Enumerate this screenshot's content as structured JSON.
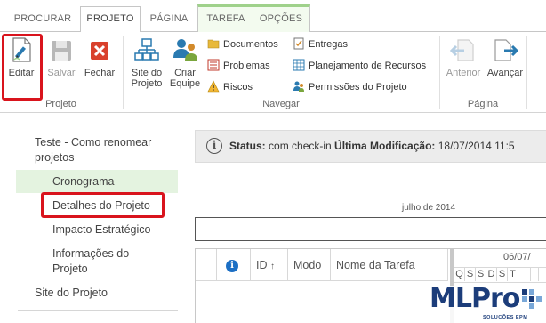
{
  "tabs": [
    {
      "label": "PROCURAR",
      "active": false
    },
    {
      "label": "PROJETO",
      "active": true
    },
    {
      "label": "PÁGINA",
      "active": false
    },
    {
      "label": "TAREFA",
      "active": false
    },
    {
      "label": "OPÇÕES",
      "active": false
    }
  ],
  "ribbon": {
    "projeto_group": {
      "label": "Projeto",
      "editar": "Editar",
      "salvar": "Salvar",
      "fechar": "Fechar"
    },
    "navegar_group": {
      "label": "Navegar",
      "site_do_projeto": [
        "Site do",
        "Projeto"
      ],
      "criar_equipe": [
        "Criar",
        "Equipe"
      ],
      "documentos": "Documentos",
      "problemas": "Problemas",
      "riscos": "Riscos",
      "entregas": "Entregas",
      "planejamento": "Planejamento de Recursos",
      "permissoes": "Permissões do Projeto"
    },
    "pagina_group": {
      "label": "Página",
      "anterior": "Anterior",
      "avancar": "Avançar"
    }
  },
  "nav": {
    "project_title": [
      "Teste - Como renomear",
      "projetos"
    ],
    "items": [
      "Cronograma",
      "Detalhes do Projeto",
      "Impacto Estratégico",
      "Informações do",
      "Projeto"
    ],
    "site": "Site do Projeto"
  },
  "status": {
    "label": "Status:",
    "text": "com check-in",
    "mod_label": "Última Modificação:",
    "mod_value": "18/07/2014 11:5"
  },
  "timeline": {
    "month": "julho de 2014"
  },
  "grid": {
    "headers": {
      "id": "ID",
      "sort_arrow": "↑",
      "modo": "Modo",
      "nome": "Nome da Tarefa"
    },
    "week": "06/07/",
    "days": [
      "Q",
      "S",
      "S",
      "D",
      "S",
      "T"
    ]
  },
  "logo": {
    "main": "MLPro",
    "sub": "SOLUÇÕES EPM"
  },
  "colors": {
    "highlight": "#d9141d",
    "context_tab": "#9fd18b",
    "selected_nav": "#e4f3e0",
    "accent_blue": "#2a7ab0",
    "logo_blue": "#1c3d7a"
  }
}
